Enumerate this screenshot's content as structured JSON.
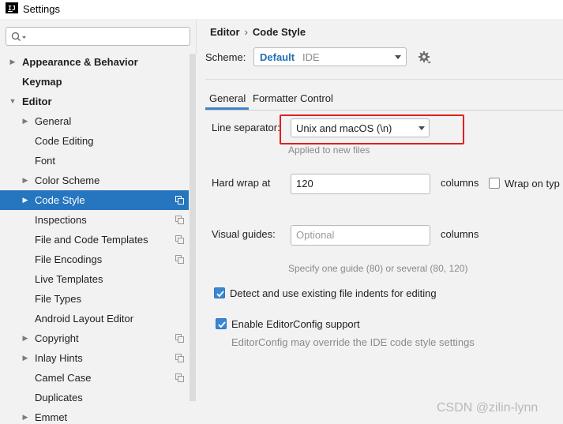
{
  "window": {
    "app_logo": "IJ",
    "title": "Settings"
  },
  "search": {
    "placeholder": ""
  },
  "sidebar": {
    "items": [
      {
        "label": "Appearance & Behavior",
        "level": 0,
        "bold": true,
        "arrow": "right"
      },
      {
        "label": "Keymap",
        "level": 0,
        "bold": true,
        "arrow": ""
      },
      {
        "label": "Editor",
        "level": 0,
        "bold": true,
        "arrow": "down"
      },
      {
        "label": "General",
        "level": 1,
        "arrow": "right"
      },
      {
        "label": "Code Editing",
        "level": 1,
        "arrow": ""
      },
      {
        "label": "Font",
        "level": 1,
        "arrow": ""
      },
      {
        "label": "Color Scheme",
        "level": 1,
        "arrow": "right"
      },
      {
        "label": "Code Style",
        "level": 1,
        "arrow": "right",
        "selected": true,
        "project_icon": true
      },
      {
        "label": "Inspections",
        "level": 1,
        "arrow": "",
        "project_icon": true
      },
      {
        "label": "File and Code Templates",
        "level": 1,
        "arrow": "",
        "project_icon": true
      },
      {
        "label": "File Encodings",
        "level": 1,
        "arrow": "",
        "project_icon": true
      },
      {
        "label": "Live Templates",
        "level": 1,
        "arrow": ""
      },
      {
        "label": "File Types",
        "level": 1,
        "arrow": ""
      },
      {
        "label": "Android Layout Editor",
        "level": 1,
        "arrow": ""
      },
      {
        "label": "Copyright",
        "level": 1,
        "arrow": "right",
        "project_icon": true
      },
      {
        "label": "Inlay Hints",
        "level": 1,
        "arrow": "right",
        "project_icon": true
      },
      {
        "label": "Camel Case",
        "level": 1,
        "arrow": "",
        "project_icon": true
      },
      {
        "label": "Duplicates",
        "level": 1,
        "arrow": ""
      },
      {
        "label": "Emmet",
        "level": 1,
        "arrow": "right"
      }
    ]
  },
  "breadcrumb": {
    "parent": "Editor",
    "separator": "›",
    "current": "Code Style"
  },
  "scheme": {
    "label": "Scheme:",
    "name": "Default",
    "type": "IDE"
  },
  "tabs": {
    "general": "General",
    "formatter": "Formatter Control"
  },
  "line_separator": {
    "label": "Line separator:",
    "value": "Unix and macOS (\\n)",
    "hint": "Applied to new files"
  },
  "hard_wrap": {
    "label": "Hard wrap at",
    "value": "120",
    "unit": "columns",
    "wrap_on_typing_label": "Wrap on typ"
  },
  "visual_guides": {
    "label": "Visual guides:",
    "placeholder": "Optional",
    "unit": "columns",
    "hint": "Specify one guide (80) or several (80, 120)"
  },
  "detect_indents": {
    "label": "Detect and use existing file indents for editing",
    "checked": true
  },
  "editorconfig": {
    "label": "Enable EditorConfig support",
    "checked": true,
    "hint": "EditorConfig may override the IDE code style settings"
  },
  "watermark": "CSDN @zilin-lynn",
  "colors": {
    "selection": "#2675bf",
    "accent": "#2470b3",
    "highlight_box": "#e02020",
    "checkbox": "#3a86d4"
  }
}
